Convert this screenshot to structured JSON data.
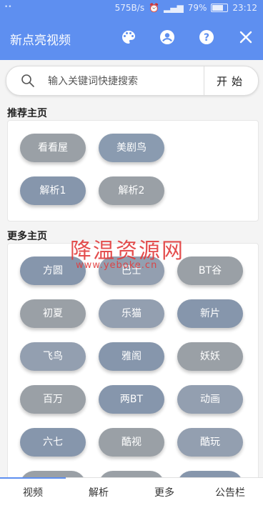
{
  "status_bar": {
    "speed": "575B/s",
    "signal_text": "..ıl",
    "battery": "79%",
    "battery_level": 0.79,
    "time": "23:12"
  },
  "app_bar": {
    "title": "新点亮视频",
    "icons": [
      "palette-icon",
      "account-icon",
      "help-icon",
      "close-icon"
    ]
  },
  "search": {
    "placeholder": "输入关键词快捷搜索",
    "button_label": "开始"
  },
  "recommended": {
    "title": "推荐主页",
    "items": [
      {
        "label": "看看屋",
        "color": "#9aa0a6"
      },
      {
        "label": "美剧鸟",
        "color": "#8a9bb0"
      },
      {
        "label": "解析1",
        "color": "#8696ac"
      },
      {
        "label": "解析2",
        "color": "#9aa0a6"
      }
    ]
  },
  "more": {
    "title": "更多主页",
    "items": [
      {
        "label": "方圆",
        "color": "#8696ac"
      },
      {
        "label": "巴士",
        "color": "#939fb0"
      },
      {
        "label": "BT谷",
        "color": "#9aa0a6"
      },
      {
        "label": "初夏",
        "color": "#9aa0a6"
      },
      {
        "label": "乐猫",
        "color": "#939fb0"
      },
      {
        "label": "新片",
        "color": "#8696ac"
      },
      {
        "label": "飞鸟",
        "color": "#939fb0"
      },
      {
        "label": "雅阁",
        "color": "#8696ac"
      },
      {
        "label": "妖妖",
        "color": "#9aa0a6"
      },
      {
        "label": "百万",
        "color": "#9aa0a6"
      },
      {
        "label": "两BT",
        "color": "#8696ac"
      },
      {
        "label": "动画",
        "color": "#939fb0"
      },
      {
        "label": "六七",
        "color": "#8696ac"
      },
      {
        "label": "酷视",
        "color": "#9aa0a6"
      },
      {
        "label": "酷玩",
        "color": "#939fb0"
      },
      {
        "label": "",
        "color": "#9aa0a6"
      },
      {
        "label": "",
        "color": "#9aa0a6"
      },
      {
        "label": "",
        "color": "#8696ac"
      }
    ]
  },
  "watermark": {
    "title": "降温资源网",
    "url": "www.yeboke.cn"
  },
  "bottom_nav": {
    "tabs": [
      "视频",
      "解析",
      "更多",
      "公告栏"
    ]
  },
  "colors": {
    "accent": "#5e8ff0"
  }
}
